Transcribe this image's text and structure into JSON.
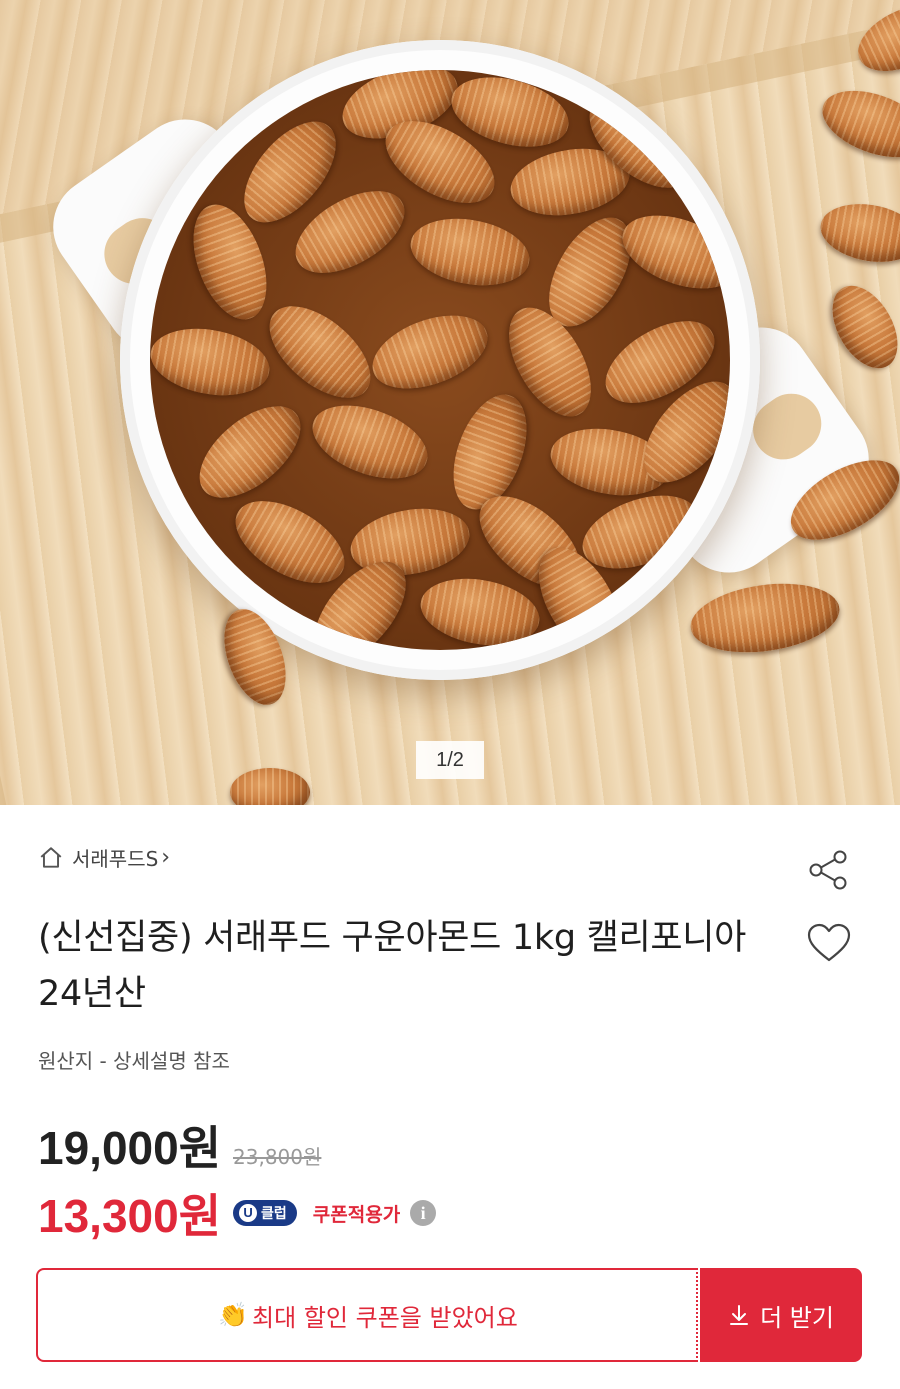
{
  "gallery": {
    "page_indicator": "1/2",
    "image_alt_icon": "almonds-photo"
  },
  "store": {
    "name": "서래푸드S",
    "home_icon": "home-icon",
    "chevron_icon": "chevron-right-icon"
  },
  "actions": {
    "share_icon": "share-icon",
    "like_icon": "heart-icon"
  },
  "product": {
    "title": "(신선집중) 서래푸드 구운아몬드 1kg 캘리포니아 24년산",
    "origin": "원산지 - 상세설명 참조"
  },
  "price": {
    "sale": "19,000원",
    "original": "23,800원",
    "coupon_price": "13,300원",
    "badge_u": "U",
    "badge_text": "클럽",
    "coupon_label": "쿠폰적용가",
    "info_icon": "info-icon"
  },
  "coupon_bar": {
    "message": "최대 할인 쿠폰을 받았어요",
    "clap_icon": "clapping-hands-icon",
    "button_label": "더 받기",
    "download_icon": "download-icon"
  },
  "colors": {
    "accent": "#e0283a",
    "badge": "#1a3a87"
  }
}
